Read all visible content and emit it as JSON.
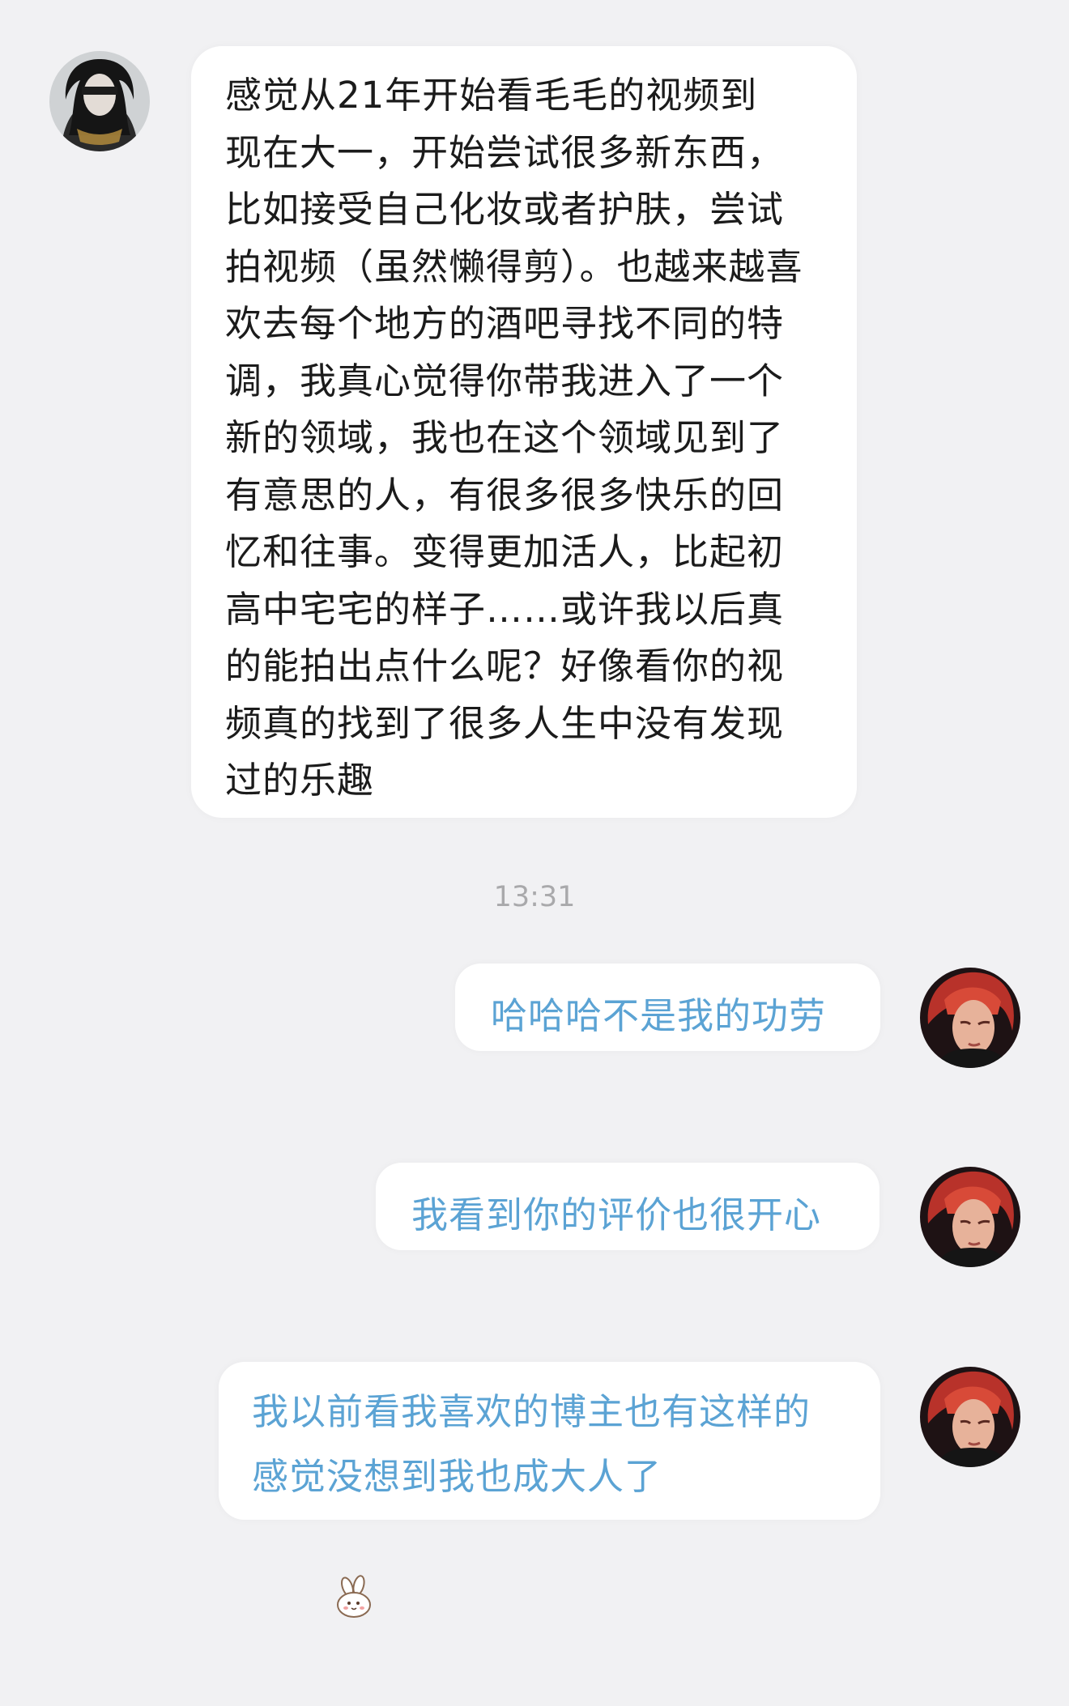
{
  "conversation": {
    "incoming": {
      "avatar_icon": "contact-avatar-icon",
      "lines": [
        "感觉从21年开始看毛毛的视频到",
        "现在大一，开始尝试很多新东西，",
        "比如接受自己化妆或者护肤，尝试",
        "拍视频（虽然懒得剪）。也越来越喜",
        "欢去每个地方的酒吧寻找不同的特",
        "调，我真心觉得你带我进入了一个",
        "新的领域，我也在这个领域见到了",
        "有意思的人，有很多很多快乐的回",
        "忆和往事。变得更加活人，比起初",
        "高中宅宅的样子……或许我以后真",
        "的能拍出点什么呢？好像看你的视",
        "频真的找到了很多人生中没有发现",
        "过的乐趣"
      ]
    },
    "timestamp": "13:31",
    "outgoing": [
      {
        "lines": [
          "哈哈哈不是我的功劳"
        ]
      },
      {
        "lines": [
          "我看到你的评价也很开心"
        ]
      },
      {
        "lines": [
          "我以前看我喜欢的博主也有这样的",
          "感觉没想到我也成大人了"
        ],
        "sticker": "bunny-sticker-icon"
      }
    ],
    "self_avatar_icon": "user-avatar-icon"
  },
  "colors": {
    "background": "#f1f1f3",
    "incoming_text": "#1b1b1b",
    "outgoing_text": "#5ba3d4",
    "timestamp_text": "#a9a9ab"
  }
}
